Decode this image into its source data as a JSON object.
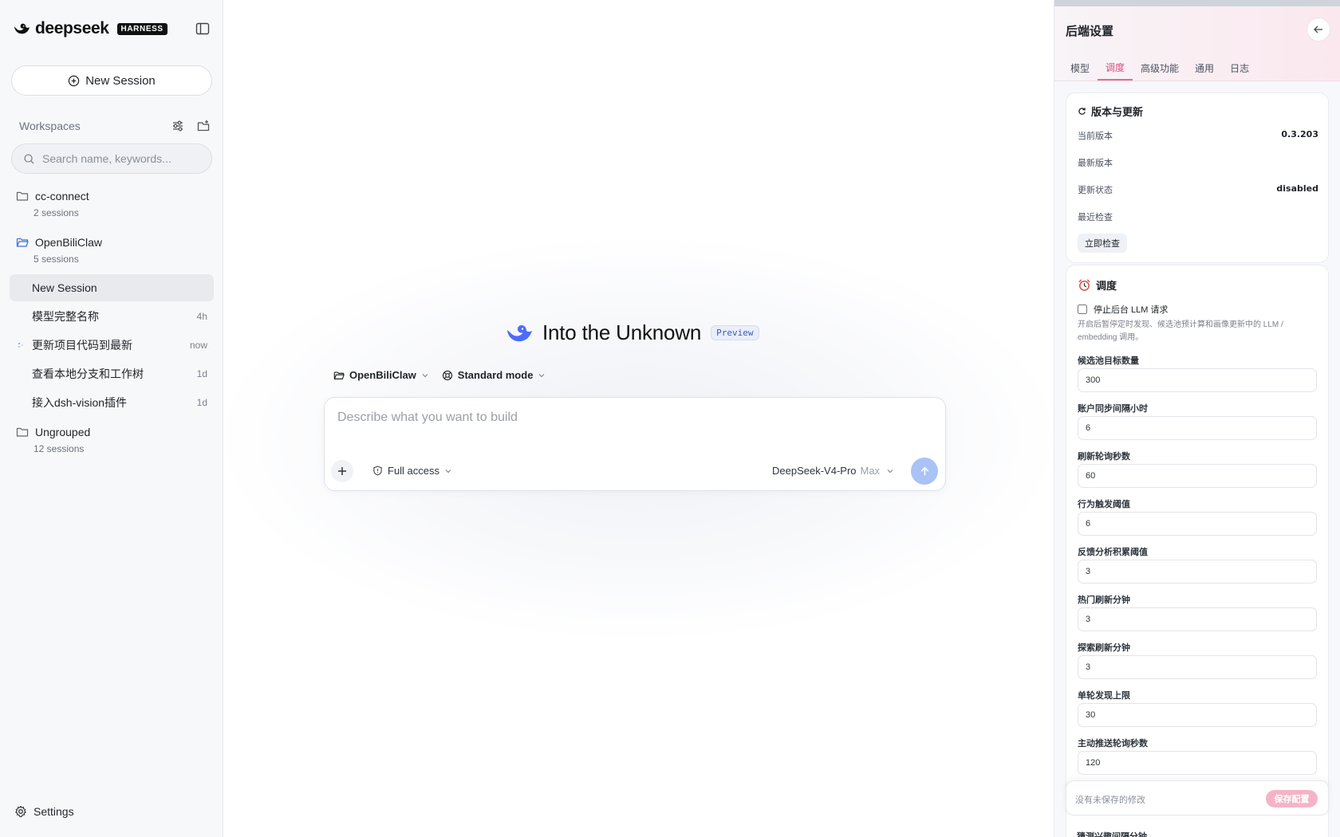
{
  "brand": {
    "name": "deepseek",
    "badge": "HARNESS"
  },
  "sidebar": {
    "new_session_label": "New Session",
    "workspaces_title": "Workspaces",
    "search_placeholder": "Search name, keywords...",
    "groups": [
      {
        "name": "cc-connect",
        "count": "2 sessions"
      },
      {
        "name": "OpenBiliClaw",
        "count": "5 sessions"
      },
      {
        "name": "Ungrouped",
        "count": "12 sessions"
      }
    ],
    "sessions": [
      {
        "title": "New Session",
        "time": ""
      },
      {
        "title": "模型完整名称",
        "time": "4h"
      },
      {
        "title": "更新项目代码到最新",
        "time": "now"
      },
      {
        "title": "查看本地分支和工作树",
        "time": "1d"
      },
      {
        "title": "接入dsh-vision插件",
        "time": "1d"
      }
    ],
    "settings_label": "Settings"
  },
  "main": {
    "hero_title": "Into the Unknown",
    "hero_badge": "Preview",
    "workspace_chip": "OpenBiliClaw",
    "mode_chip": "Standard mode",
    "composer_placeholder": "Describe what you want to build",
    "access_label": "Full access",
    "model_name": "DeepSeek-V4-Pro",
    "model_effort": "Max"
  },
  "panel": {
    "title": "后端设置",
    "tabs": [
      "模型",
      "调度",
      "高级功能",
      "通用",
      "日志"
    ],
    "active_tab": "调度",
    "version_card": {
      "title": "版本与更新",
      "rows": [
        {
          "key": "当前版本",
          "value": "0.3.203"
        },
        {
          "key": "最新版本",
          "value": ""
        },
        {
          "key": "更新状态",
          "value": "disabled"
        },
        {
          "key": "最近检查",
          "value": ""
        }
      ],
      "check_button": "立即检查"
    },
    "schedule_card": {
      "title": "调度",
      "checkbox_label": "停止后台 LLM 请求",
      "checkbox_checked": false,
      "hint": "开启后暂停定时发现、候选池预计算和画像更新中的 LLM / embedding 调用。",
      "fields": [
        {
          "label": "候选池目标数量",
          "value": "300"
        },
        {
          "label": "账户同步间隔小时",
          "value": "6"
        },
        {
          "label": "刷新轮询秒数",
          "value": "60"
        },
        {
          "label": "行为触发阈值",
          "value": "6"
        },
        {
          "label": "反馈分析积累阈值",
          "value": "3"
        },
        {
          "label": "热门刷新分钟",
          "value": "3"
        },
        {
          "label": "探索刷新分钟",
          "value": "3"
        },
        {
          "label": "单轮发现上限",
          "value": "30"
        },
        {
          "label": "主动推送轮询秒数",
          "value": "120"
        }
      ],
      "cut_label": "猜测兴趣间隔分钟"
    },
    "save_bar": {
      "status": "没有未保存的修改",
      "button": "保存配置"
    }
  },
  "colors": {
    "accent_pink": "#e56b92",
    "send_blue": "#aac3f5",
    "folder_blue": "#3b6fd8"
  }
}
